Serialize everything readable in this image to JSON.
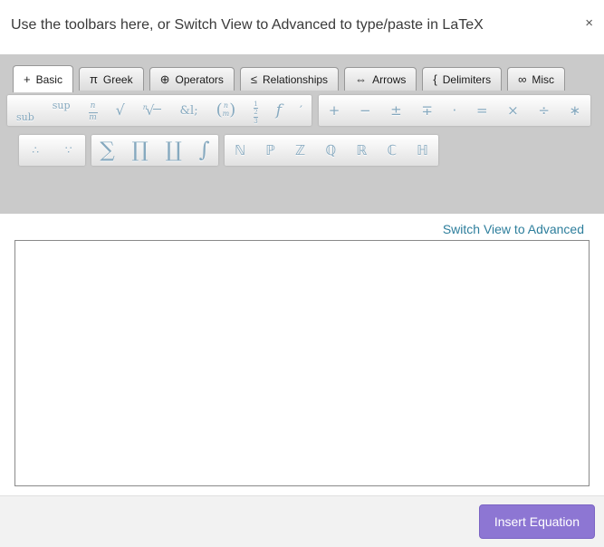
{
  "dialog": {
    "title": "Use the toolbars here, or Switch View to Advanced to type/paste in LaTeX",
    "close_label": "×"
  },
  "tabs": [
    {
      "icon": "+",
      "label": "Basic",
      "active": true
    },
    {
      "icon": "π",
      "label": "Greek",
      "active": false
    },
    {
      "icon": "⊕",
      "label": "Operators",
      "active": false
    },
    {
      "icon": "≤",
      "label": "Relationships",
      "active": false
    },
    {
      "icon": "⇔",
      "label": "Arrows",
      "active": false
    },
    {
      "icon": "{",
      "label": "Delimiters",
      "active": false
    },
    {
      "icon": "∞",
      "label": "Misc",
      "active": false
    }
  ],
  "toolbar": {
    "sub": "sub",
    "sup": "sup",
    "frac": {
      "num": "n",
      "den": "m"
    },
    "sqrt": "√",
    "nthroot": {
      "index": "n",
      "radical": "√"
    },
    "entity": "&l;",
    "binom": {
      "open": "(",
      "num": "n",
      "den": "m",
      "close": ")"
    },
    "stack": {
      "top": "1",
      "mid": "2",
      "bot": "3"
    },
    "func": "f",
    "prime": "′",
    "operators": [
      "+",
      "−",
      "±",
      "∓",
      "·",
      "=",
      "×",
      "÷",
      "∗"
    ],
    "logic": [
      "∴",
      "∵"
    ],
    "big_operators": [
      "∑",
      "∏",
      "∐",
      "∫"
    ],
    "number_sets": [
      "ℕ",
      "ℙ",
      "ℤ",
      "ℚ",
      "ℝ",
      "ℂ",
      "ℍ"
    ]
  },
  "advanced_link": "Switch View to Advanced",
  "equation_input": {
    "value": "",
    "placeholder": ""
  },
  "footer": {
    "insert_button": "Insert Equation"
  },
  "colors": {
    "accent_purple": "#8d76d3",
    "link_teal": "#2d7e9c",
    "symbol_blue": "#86a9bf",
    "toolbar_gray": "#cacaca"
  }
}
